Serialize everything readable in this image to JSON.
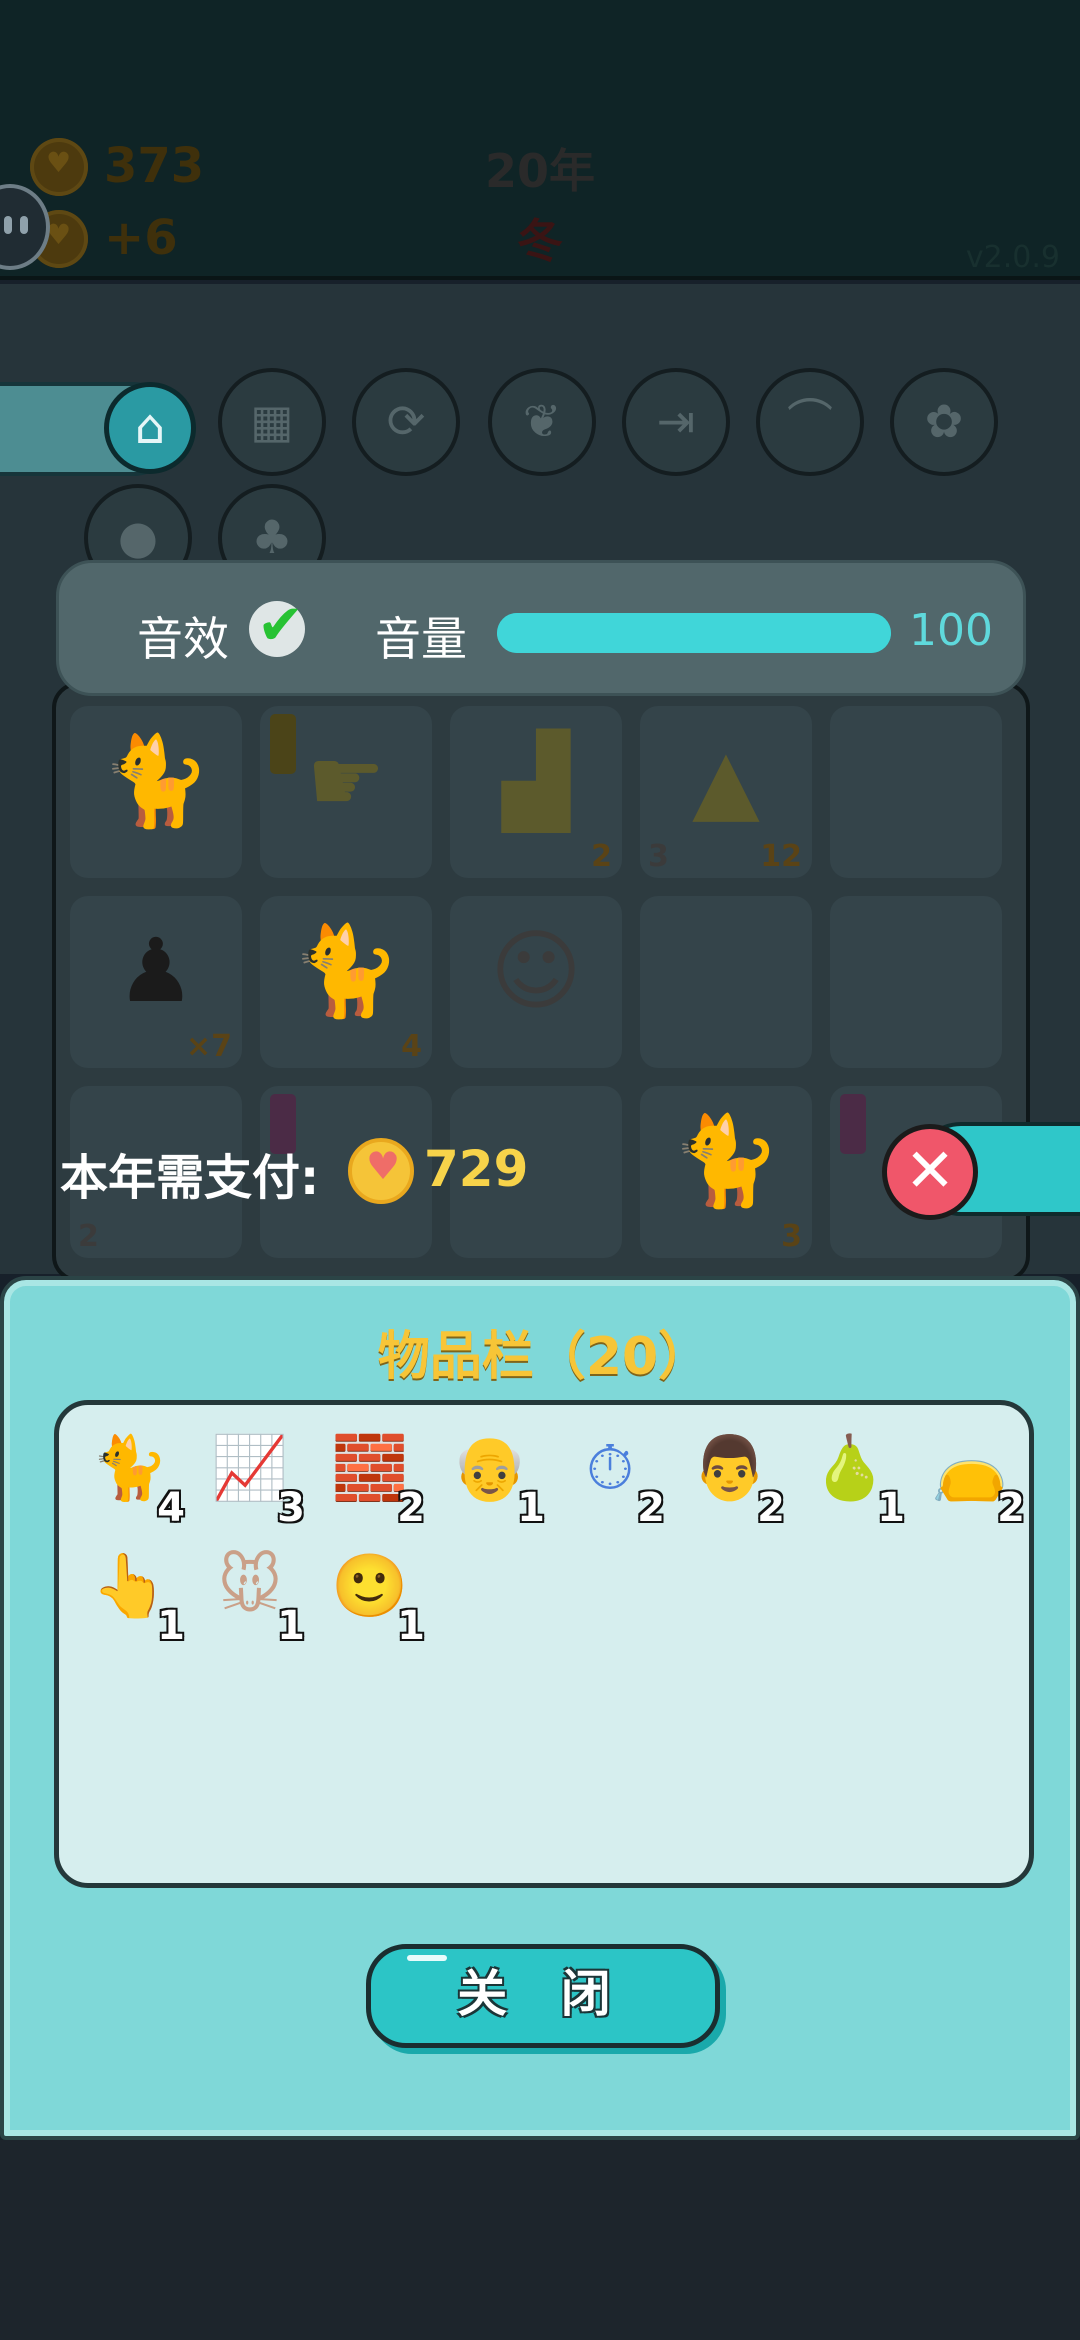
{
  "header": {
    "coins": "373",
    "income": "+6",
    "year": "20年",
    "season": "冬",
    "version": "v2.0.9"
  },
  "settings": {
    "sound_label": "音效",
    "sound_checked": true,
    "volume_label": "音量",
    "volume_value": "100",
    "volume_level": 1.0
  },
  "payment": {
    "label": "本年需支付:",
    "amount": "729"
  },
  "board": {
    "cells": [
      {
        "icon": "cat-icon",
        "count": ""
      },
      {
        "icon": "pointing-hand-icon",
        "count": ""
      },
      {
        "icon": "growth-chart-icon",
        "count": "2"
      },
      {
        "icon": "gold-bars-icon",
        "count": "12",
        "count_left": "3"
      },
      {
        "icon": "",
        "count": ""
      },
      {
        "icon": "garbage-bag-icon",
        "count": "×7"
      },
      {
        "icon": "cat-icon",
        "count": "4"
      },
      {
        "icon": "man-face-icon",
        "count": ""
      },
      {
        "icon": "",
        "count": ""
      },
      {
        "icon": "",
        "count": ""
      },
      {
        "icon": "timer-icon",
        "count": "",
        "count_left": "2"
      },
      {
        "icon": "old-man-icon",
        "count": ""
      },
      {
        "icon": "",
        "count": ""
      },
      {
        "icon": "cat-icon",
        "count": "3"
      },
      {
        "icon": "",
        "count": ""
      }
    ]
  },
  "inventory": {
    "title": "物品栏（20）",
    "items": [
      {
        "icon": "cat-icon",
        "glyph": "🐈",
        "count": "4"
      },
      {
        "icon": "growth-chart-icon",
        "glyph": "📈",
        "count": "3"
      },
      {
        "icon": "gold-bars-icon",
        "glyph": "🧱",
        "count": "2"
      },
      {
        "icon": "grandpa-glasses-icon",
        "glyph": "👴",
        "count": "1"
      },
      {
        "icon": "stopwatch-icon",
        "glyph": "⏱",
        "count": "2"
      },
      {
        "icon": "bald-man-icon",
        "glyph": "👨",
        "count": "2"
      },
      {
        "icon": "pear-icon",
        "glyph": "🍐",
        "count": "1"
      },
      {
        "icon": "garbage-bag-icon",
        "glyph": "👝",
        "count": "2"
      },
      {
        "icon": "pointing-hand-icon",
        "glyph": "👆",
        "count": "1"
      },
      {
        "icon": "mouse-icon",
        "glyph": "🐭",
        "count": "1"
      },
      {
        "icon": "man-face-icon",
        "glyph": "🙂",
        "count": "1"
      }
    ],
    "close_label": "关 闭"
  },
  "colors": {
    "panel": "#7fd8d8",
    "accent": "#2cc5c6",
    "gold": "#f7c537",
    "danger": "#f0566a"
  }
}
